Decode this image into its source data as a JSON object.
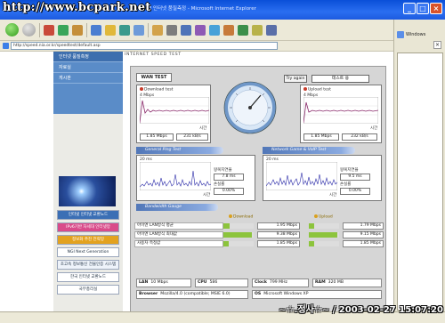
{
  "window": {
    "watermark": "http://www.bcpark.net",
    "title": "인터넷 인터넷 품질측정 - Microsoft Internet Explorer"
  },
  "toolbar": {
    "sidepanel_title": "Windows"
  },
  "address": {
    "url": "http://speed.nia.or.kr/speedtest/default.asp"
  },
  "sidebar": {
    "nav": [
      "인터넷 품질측정",
      "자료실",
      "게시판"
    ],
    "buttons": [
      "인터넷 인터넷 교환노드",
      "IPv6기반 차세대 인터넷망",
      "정보화 추진 전략망",
      "NGI Next Generation",
      "초고속 정보통신 건물인증 시스템",
      "한국 인터넷 교환노드",
      "국무총리실"
    ]
  },
  "header": {
    "title": "INTERNET SPEED TEST"
  },
  "test": {
    "tab_label": "WAN TEST",
    "try_again": "Try again",
    "server_name": "테스트 용",
    "download": {
      "title": "Download test",
      "axis_max": "4 Mbps",
      "axis_unit": "시간",
      "mbps": "1.85 Mbps",
      "kbs": "231 kB/s"
    },
    "upload": {
      "title": "Upload test",
      "axis_max": "4 Mbps",
      "axis_unit": "시간",
      "mbps": "1.85 Mbps",
      "kbs": "232 kB/s"
    },
    "ping": {
      "title": "General Ping Test",
      "axis_max": "20 ms",
      "axis_unit": "시간",
      "latency_label": "왕복지연율",
      "latency": "7.8 ms",
      "loss_label": "손실률",
      "loss": "0.00%"
    },
    "game": {
      "title": "Network Game & VoIP Test",
      "axis_max": "20 ms",
      "axis_unit": "시간",
      "latency_label": "왕복지연율",
      "latency": "9.5 ms",
      "loss_label": "손실률",
      "loss": "0.00%"
    },
    "bandwidth": {
      "title": "Bandwidth Gauge",
      "col_download": "Download",
      "col_upload": "Upload",
      "rows": [
        {
          "label": "아이엔 LAN방식 평균",
          "down": "1.95 Mbps",
          "up": "1.79 Mbps",
          "down_frac": 0.2,
          "up_frac": 0.18
        },
        {
          "label": "아이엔 LAN방식 최대값",
          "down": "9.38 Mbps",
          "up": "9.15 Mbps",
          "down_frac": 0.95,
          "up_frac": 0.93
        },
        {
          "label": "사용자 측정값",
          "down": "1.85 Mbps",
          "up": "1.85 Mbps",
          "down_frac": 0.19,
          "up_frac": 0.19
        }
      ]
    },
    "system": {
      "lan_label": "LAN",
      "lan": "10 Mbps",
      "cpu_label": "CPU",
      "cpu": "586",
      "clock_label": "Clock",
      "clock": "799 MHz",
      "ram_label": "RAM",
      "ram": "320 MB",
      "browser_label": "Browser",
      "browser": "Mozilla/4.0 (compatible; MSIE 6.0)",
      "os_label": "OS",
      "os": "Microsoft Windows XP"
    }
  },
  "stamp": "~☆.정사☆~ / 2003-02-27 15:07:20"
}
